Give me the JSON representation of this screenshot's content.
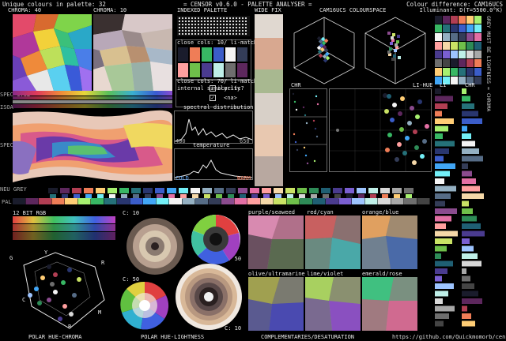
{
  "header": {
    "unique_colours": "Unique colours in palette: 32",
    "title": "= CENSOR v0.6.0 - PALETTE ANALYSER =",
    "colour_difference": "Colour difference: CAM16UCS",
    "illuminant": "Illuminant: D(T=5500.0°K)"
  },
  "labels": {
    "chroma_40": "CHROMA: 40",
    "chroma_10": "CHROMA: 10",
    "indexed_palette": "INDEXED PALETTE",
    "wide_fix": "WIDE FIX",
    "cam16ucs_colourspace": "CAM16UCS COLOURSPACE",
    "spec_cycl": "SPEC CYCL",
    "isoa": "ISOA",
    "spec_rgb": "SPEC RGB",
    "neu_grey": "NEU GREY",
    "pal": "PAL",
    "bit12_rgb": "12 BIT RGB",
    "c10_a": "C: 10",
    "c10_b": "C: 10",
    "c50_a": "C: 50",
    "c50_b": "C: 50",
    "chr_left": "CHR",
    "li_hue": "LI-HUE",
    "li": "LI",
    "chr_right": "CHR",
    "side_caption": "GREY MUST BE LIGHTNESS = CHROMA",
    "polar_hue_chroma": "POLAR HUE-CHROMA",
    "polar_hue_lightness": "POLAR HUE-LIGHTNESS",
    "complementaries": "COMPLEMENTARIES/DESATURATION",
    "url": "https://github.com/Quickmomorb/censor"
  },
  "similarity": {
    "close_cols_a": "close cols: 10/ li-match",
    "close_cols_b": "close cols: 70/ li-match",
    "internal_similarity": "internal similarity",
    "acyclic": "acyclic?",
    "check_1": "✓",
    "check_2": "✓",
    "na": "<na>"
  },
  "spectral": {
    "title": "spectral distribution",
    "left_tick": "400",
    "right_tick": "650"
  },
  "temperature": {
    "title": "temperature",
    "cold": "COLD",
    "warm": "WARM"
  },
  "polar": {
    "G": "G",
    "Y": "Y",
    "R": "R",
    "C": "C",
    "M": "M",
    "B": "B"
  },
  "complements": {
    "purple_seaweed": "purple/seaweed",
    "red_cyan": "red/cyan",
    "orange_blue": "orange/blue",
    "olive_ultramarine": "olive/ultramarine",
    "lime_violet": "lime/violet",
    "emerald_rose": "emerald/rose"
  },
  "palette": [
    "#1a1c2c",
    "#5d275d",
    "#b13e53",
    "#ef7d57",
    "#ffcd75",
    "#a7f070",
    "#38b764",
    "#257179",
    "#29366f",
    "#3b5dc9",
    "#41a6f6",
    "#73eff7",
    "#f4f4f4",
    "#94b0c2",
    "#566c86",
    "#333c57",
    "#8b4b8e",
    "#e36fa4",
    "#ff9f9f",
    "#f5d8a8",
    "#c9e265",
    "#6fbf4a",
    "#2e8b57",
    "#1f5f73",
    "#4a3b8f",
    "#7a5fd1",
    "#9dc4ff",
    "#bfefe8",
    "#d8d8d8",
    "#a8a8a8",
    "#6e6e6e",
    "#444444"
  ]
}
